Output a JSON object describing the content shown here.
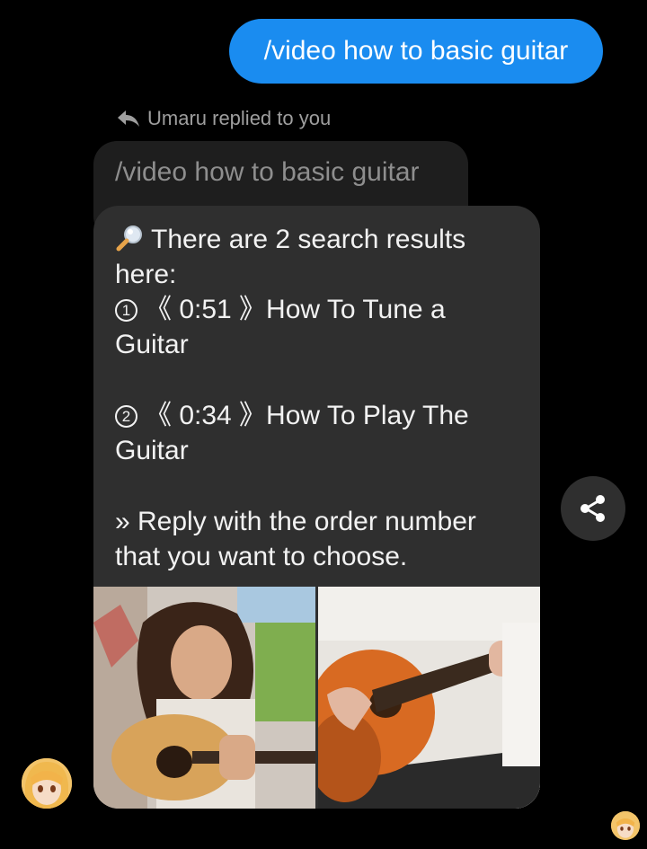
{
  "sent_message": {
    "text": "/video how to basic guitar"
  },
  "reply_meta": {
    "icon": "reply-arrow-icon",
    "text": "Umaru replied to you"
  },
  "quoted_message": {
    "text": "/video how to basic guitar"
  },
  "bot_message": {
    "intro_line1": "There are 2 search results",
    "intro_line2": "here:",
    "results": [
      {
        "number": "1",
        "line1": "《 0:51 》How To Tune a",
        "line2": "Guitar"
      },
      {
        "number": "2",
        "line1": "《 0:34 》How To Play The",
        "line2": "Guitar"
      }
    ],
    "footer_line1": "» Reply with the order number",
    "footer_line2": "that you want to choose."
  },
  "colors": {
    "sent_bubble": "#1a8cf0",
    "received_bubble": "#2f2f2f",
    "background": "#000000"
  },
  "icons": [
    "search-icon",
    "share-icon",
    "reply-arrow-icon"
  ]
}
